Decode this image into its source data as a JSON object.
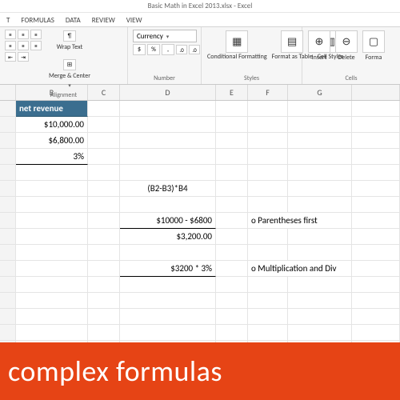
{
  "title": "Basic Math in Excel 2013.xlsx - Excel",
  "tabs": {
    "t0": "T",
    "t1": "FORMULAS",
    "t2": "DATA",
    "t3": "REVIEW",
    "t4": "VIEW"
  },
  "ribbon": {
    "alignment": {
      "label": "Alignment",
      "wrap": "Wrap Text",
      "merge": "Merge & Center"
    },
    "number": {
      "label": "Number",
      "format": "Currency"
    },
    "styles": {
      "label": "Styles",
      "cond": "Conditional Formatting",
      "table": "Format as Table",
      "cell": "Cell Styles"
    },
    "cells": {
      "label": "Cells",
      "insert": "Insert",
      "delete": "Delete",
      "format": "Forma"
    }
  },
  "cols": {
    "b": "B",
    "c": "C",
    "d": "D",
    "e": "E",
    "f": "F",
    "g": "G"
  },
  "rows": {
    "r1": {
      "b": "net revenue"
    },
    "r2": {
      "b": "$10,000.00"
    },
    "r3": {
      "b": "$6,800.00"
    },
    "r4": {
      "b": "3%"
    },
    "r6": {
      "d": "(B2-B3)*B4"
    },
    "r8": {
      "d": "$10000 - $6800",
      "f": "o Parentheses first"
    },
    "r9": {
      "d": "$3,200.00"
    },
    "r11": {
      "d": "$3200 * 3%",
      "f": "o Multiplication and Div"
    }
  },
  "caption": "complex formulas"
}
